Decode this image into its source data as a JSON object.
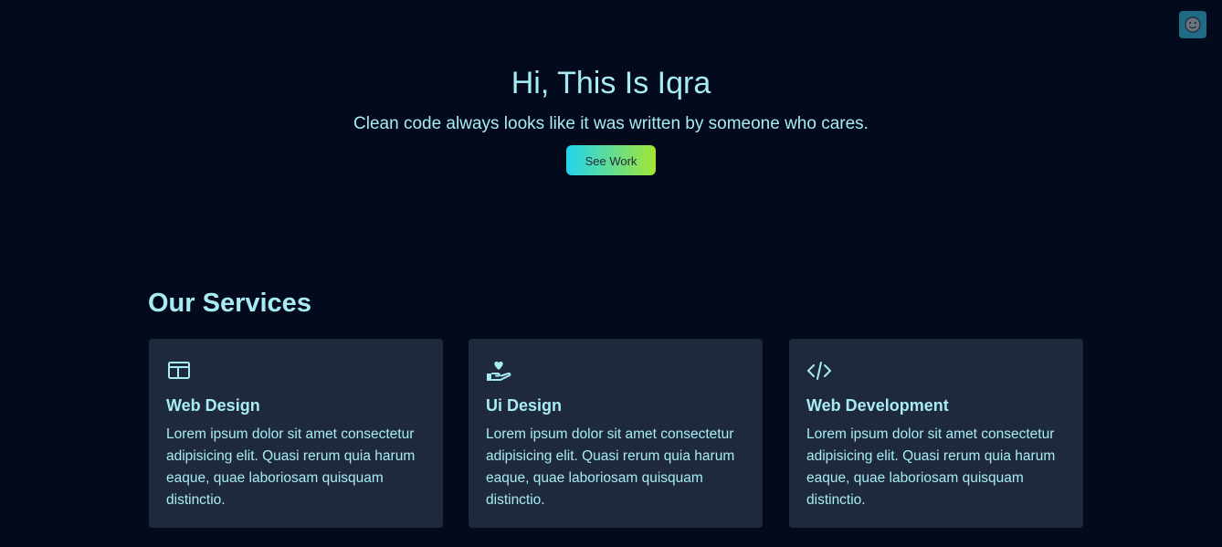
{
  "theme_toggle": {
    "icon": "smiley-face-icon"
  },
  "hero": {
    "title": "Hi, This Is Iqra",
    "subtitle": "Clean code always looks like it was written by someone who cares.",
    "button_label": "See Work"
  },
  "colors": {
    "background": "#030a1c",
    "card": "#1e293b",
    "text": "#a7ecf5",
    "button_gradient_start": "#22d3ee",
    "button_gradient_end": "#a3e635",
    "toggle_bg": "#1f6a84"
  },
  "services": {
    "title": "Our Services",
    "items": [
      {
        "icon": "browser-window-icon",
        "title": "Web Design",
        "text": "Lorem ipsum dolor sit amet consectetur adipisicing elit. Quasi rerum quia harum eaque, quae laboriosam quisquam distinctio."
      },
      {
        "icon": "hand-heart-icon",
        "title": "Ui Design",
        "text": "Lorem ipsum dolor sit amet consectetur adipisicing elit. Quasi rerum quia harum eaque, quae laboriosam quisquam distinctio."
      },
      {
        "icon": "code-icon",
        "title": "Web Development",
        "text": "Lorem ipsum dolor sit amet consectetur adipisicing elit. Quasi rerum quia harum eaque, quae laboriosam quisquam distinctio."
      }
    ]
  }
}
